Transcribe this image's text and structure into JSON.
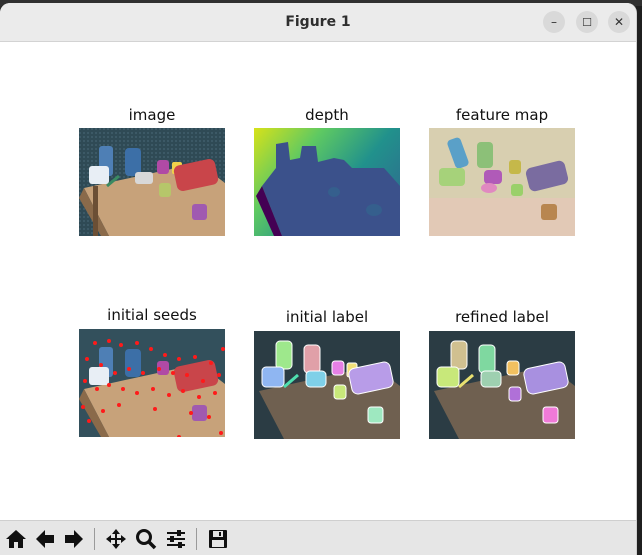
{
  "window": {
    "title": "Figure 1"
  },
  "topstrip_text": "…",
  "window_controls": {
    "minimize": "–",
    "maximize": "☐",
    "close": "✕"
  },
  "panels": [
    {
      "title": "image"
    },
    {
      "title": "depth"
    },
    {
      "title": "feature map"
    },
    {
      "title": "initial seeds"
    },
    {
      "title": "initial label"
    },
    {
      "title": "refined label"
    }
  ],
  "toolbar": {
    "icons": [
      "home-icon",
      "back-arrow-icon",
      "forward-arrow-icon",
      "pan-icon",
      "zoom-icon",
      "configure-subplots-icon",
      "save-icon"
    ]
  }
}
